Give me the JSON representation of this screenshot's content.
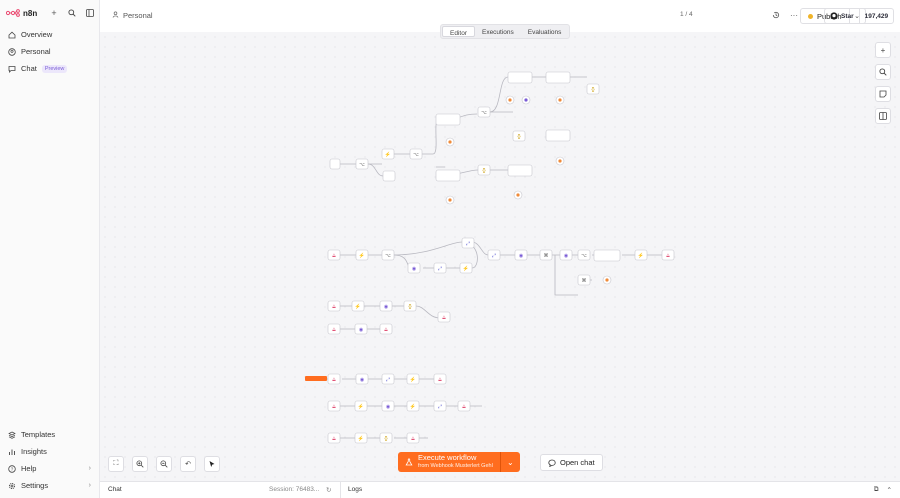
{
  "app": {
    "name": "n8n"
  },
  "sidebar": {
    "top_items": [
      {
        "label": "Overview",
        "icon": "home-icon"
      },
      {
        "label": "Personal",
        "icon": "user-icon"
      },
      {
        "label": "Chat",
        "icon": "chat-icon",
        "badge": "Preview"
      }
    ],
    "bottom_items": [
      {
        "label": "Templates",
        "icon": "templates-icon"
      },
      {
        "label": "Insights",
        "icon": "insights-icon"
      },
      {
        "label": "Help",
        "icon": "help-icon"
      },
      {
        "label": "Settings",
        "icon": "settings-icon"
      }
    ]
  },
  "header": {
    "breadcrumb": "Personal",
    "tabs": [
      "Editor",
      "Executions",
      "Evaluations"
    ],
    "active_tab": "Editor",
    "pager": "1 / 4",
    "publish_label": "Publish",
    "github_star": "Star",
    "github_count": "197,429"
  },
  "canvas": {
    "execute_title": "Execute workflow",
    "execute_sub": "from Webhook Musterlert Gehl",
    "open_chat": "Open chat",
    "sticky_label": ""
  },
  "footer": {
    "chat": "Chat",
    "session": "Session: 76483...",
    "logs": "Logs"
  },
  "colors": {
    "accent": "#ff6d1f",
    "publish_dot": "#f0b429",
    "preview_badge": "#7a5cd6"
  }
}
